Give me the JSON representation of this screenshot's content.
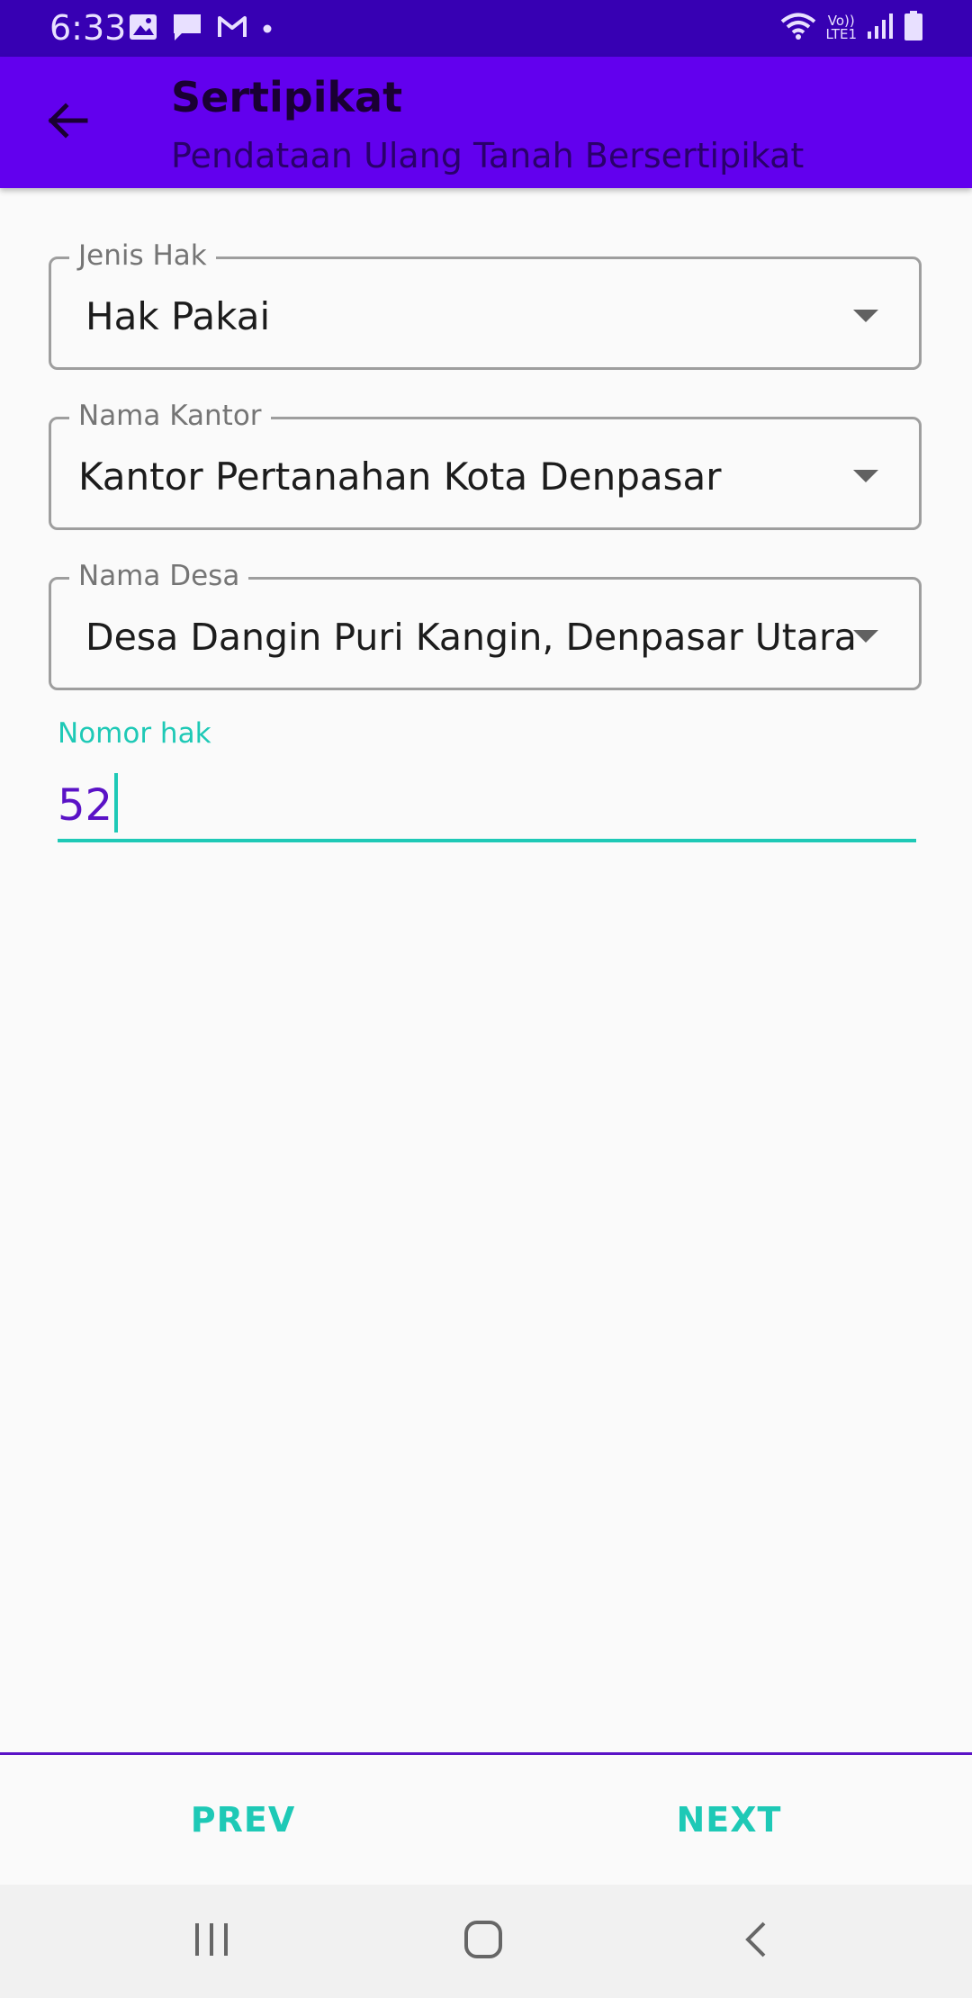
{
  "status_bar": {
    "time": "6:33",
    "left_icons": [
      "image-icon",
      "message-icon",
      "gmail-icon",
      "dot-icon"
    ],
    "volte_line1": "Vo))",
    "volte_line2": "LTE1",
    "right_icons": [
      "wifi-icon",
      "signal-icon",
      "battery-icon"
    ]
  },
  "app_bar": {
    "title": "Sertipikat",
    "subtitle": "Pendataan Ulang Tanah Bersertipikat",
    "back_icon": "arrow-left-icon"
  },
  "form": {
    "jenis_hak": {
      "label": "Jenis Hak",
      "value": "Hak Pakai"
    },
    "nama_kantor": {
      "label": "Nama Kantor",
      "value": "Kantor Pertanahan Kota Denpasar"
    },
    "nama_desa": {
      "label": "Nama Desa",
      "value": "Desa Dangin Puri Kangin, Denpasar Utara"
    },
    "nomor_hak": {
      "label": "Nomor hak",
      "value": "52"
    }
  },
  "bottom_nav": {
    "prev_label": "PREV",
    "next_label": "NEXT"
  },
  "colors": {
    "status_bar": "#3700b3",
    "app_bar": "#6200ee",
    "accent": "#1ec9b6",
    "input_text": "#5a12c6"
  },
  "system_nav": {
    "icons": [
      "recents-icon",
      "home-icon",
      "back-icon"
    ]
  }
}
